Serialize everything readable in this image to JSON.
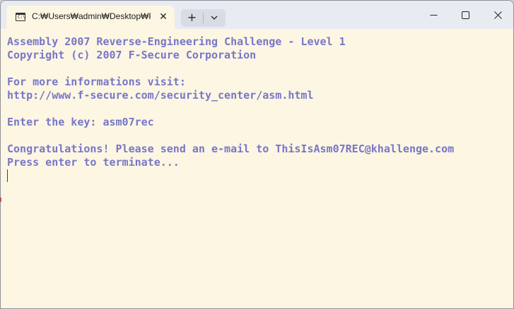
{
  "window": {
    "tab_title": "C:₩Users₩admin₩Desktop₩F",
    "icons": {
      "tab": "console-icon",
      "close_tab": "close-icon",
      "new_tab": "plus-icon",
      "dropdown": "chevron-down-icon",
      "minimize": "minimize-icon",
      "maximize": "maximize-icon",
      "close": "close-icon"
    },
    "tab_icon_glyph": "C:\\",
    "tab_close_glyph": "✕",
    "new_tab_glyph": "+"
  },
  "console": {
    "lines": [
      "Assembly 2007 Reverse-Engineering Challenge - Level 1",
      "Copyright (c) 2007 F-Secure Corporation",
      "",
      "For more informations visit:",
      "http://www.f-secure.com/security_center/asm.html",
      "",
      "Enter the key: asm07rec",
      "",
      "Congratulations! Please send an e-mail to ThisIsAsm07REC@khallenge.com",
      "Press enter to terminate..."
    ],
    "text_color": "#7777c8",
    "background": "#fdf6e3"
  }
}
